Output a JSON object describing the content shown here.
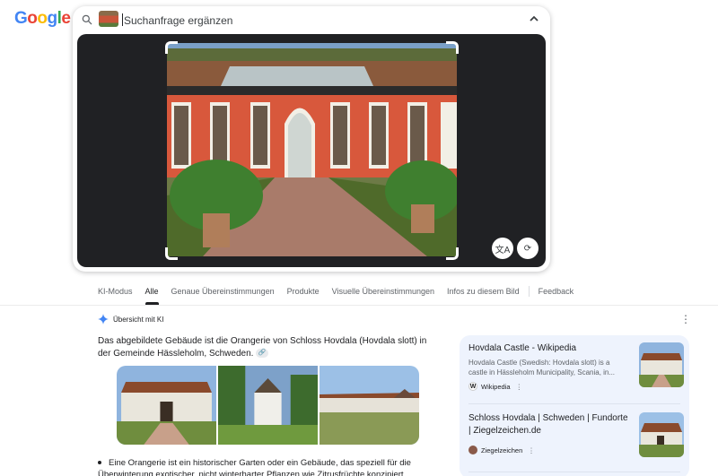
{
  "logo": {
    "text": "Google"
  },
  "search": {
    "placeholder": "Suchanfrage ergänzen"
  },
  "tabs": [
    {
      "label": "KI-Modus"
    },
    {
      "label": "Alle"
    },
    {
      "label": "Genaue Übereinstimmungen"
    },
    {
      "label": "Produkte"
    },
    {
      "label": "Visuelle Übereinstimmungen"
    },
    {
      "label": "Infos zu diesem Bild"
    },
    {
      "label": "Feedback"
    }
  ],
  "active_tab": "Alle",
  "ai_overview": {
    "heading": "Übersicht mit KI",
    "text": "Das abgebildete Gebäude ist die Orangerie von Schloss Hovdala (Hovdala slott) in der Gemeinde Hässleholm, Schweden.",
    "bullet": "Eine Orangerie ist ein historischer Garten oder ein Gebäude, das speziell für die Überwinterung exotischer, nicht winterharter Pflanzen wie Zitrusfrüchte konzipiert"
  },
  "sources": [
    {
      "title": "Hovdala Castle - Wikipedia",
      "snippet": "Hovdala Castle (Swedish: Hovdala slott) is a castle in Hässleholm Municipality, Scania, in...",
      "site": "Wikipedia",
      "favicon": "W"
    },
    {
      "title": "Schloss Hovdala | Schweden | Fundorte | Ziegelzeichen.de",
      "snippet": "",
      "site": "Ziegelzeichen",
      "favicon": ""
    }
  ],
  "colors": {
    "accent": "#4285f4",
    "panel": "#eef3fd",
    "viewer_bg": "#202124"
  },
  "icons": [
    "search-icon",
    "chevron-up-icon",
    "translate-icon",
    "rotate-icon",
    "gemini-sparkle-icon",
    "more-vert-icon",
    "link-icon"
  ]
}
